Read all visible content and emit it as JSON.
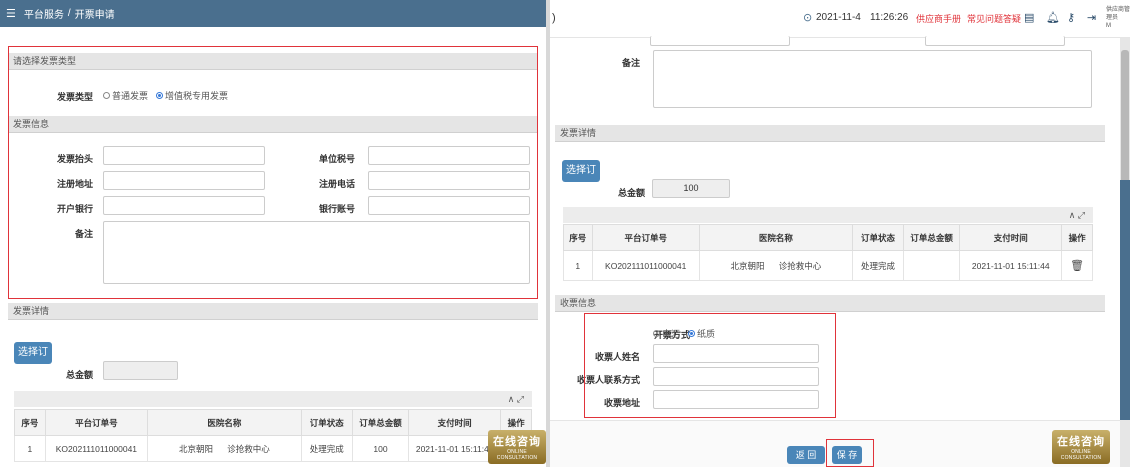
{
  "left": {
    "breadcrumb": {
      "menu_icon": "☰",
      "root": "平台服务",
      "sep": "/",
      "current": "开票申请"
    },
    "sec_type": "请选择发票类型",
    "invoice_type_label": "发票类型",
    "invoice_type_options": [
      "普通发票",
      "增值税专用发票"
    ],
    "invoice_type_selected": "增值税专用发票",
    "sec_info": "发票信息",
    "fields": {
      "title": "发票抬头",
      "tax_no": "单位税号",
      "reg_addr": "注册地址",
      "reg_phone": "注册电话",
      "bank": "开户银行",
      "bank_acct": "银行账号",
      "remark": "备注"
    },
    "sec_detail": "发票详情",
    "select_order": "选择订单",
    "total_label": "总金额",
    "table": {
      "headers": [
        "序号",
        "平台订单号",
        "医院名称",
        "订单状态",
        "订单总金额",
        "支付时间",
        "操作"
      ],
      "rows": [
        [
          "1",
          "KO202111011000041",
          "北京朝阳",
          "诊抢救中心",
          "处理完成",
          "100",
          "2021-11-01 15:11:44"
        ]
      ]
    },
    "table_tools": "∧ ⤢"
  },
  "right": {
    "top": {
      "date": "2021-11-4",
      "time": "11:26:26",
      "links": [
        "供应商手册",
        "常见问题答疑"
      ],
      "user_line1": "供应商管理员",
      "user_line2": "M"
    },
    "remark": "备注",
    "sec_detail": "发票详情",
    "select_order": "选择订单",
    "total_label": "总金额",
    "total_value": "100",
    "table_tools": "∧ ⤢",
    "table": {
      "headers": [
        "序号",
        "平台订单号",
        "医院名称",
        "订单状态",
        "订单总金额",
        "支付时间",
        "操作"
      ],
      "rows": [
        [
          "1",
          "KO202111011000041",
          "北京朝阳",
          "诊抢救中心",
          "处理完成",
          "",
          "2021-11-01 15:11:44"
        ]
      ]
    },
    "sec_receive": "收票信息",
    "receive_method_label": "开票方式",
    "receive_options": [
      "电汇",
      "纸质"
    ],
    "receive_selected": "纸质",
    "receiver_name": "收票人姓名",
    "receiver_contact": "收票人联系方式",
    "receiver_addr": "收票地址",
    "back": "返 回",
    "save": "保 存"
  },
  "consult": {
    "cn": "在线咨询",
    "en": "ONLINE CONSULTATION"
  },
  "colors": {
    "topbar": "#4a6f8e",
    "red": "#e0333a",
    "blue": "#4a86b8",
    "link": "#e0333a"
  }
}
